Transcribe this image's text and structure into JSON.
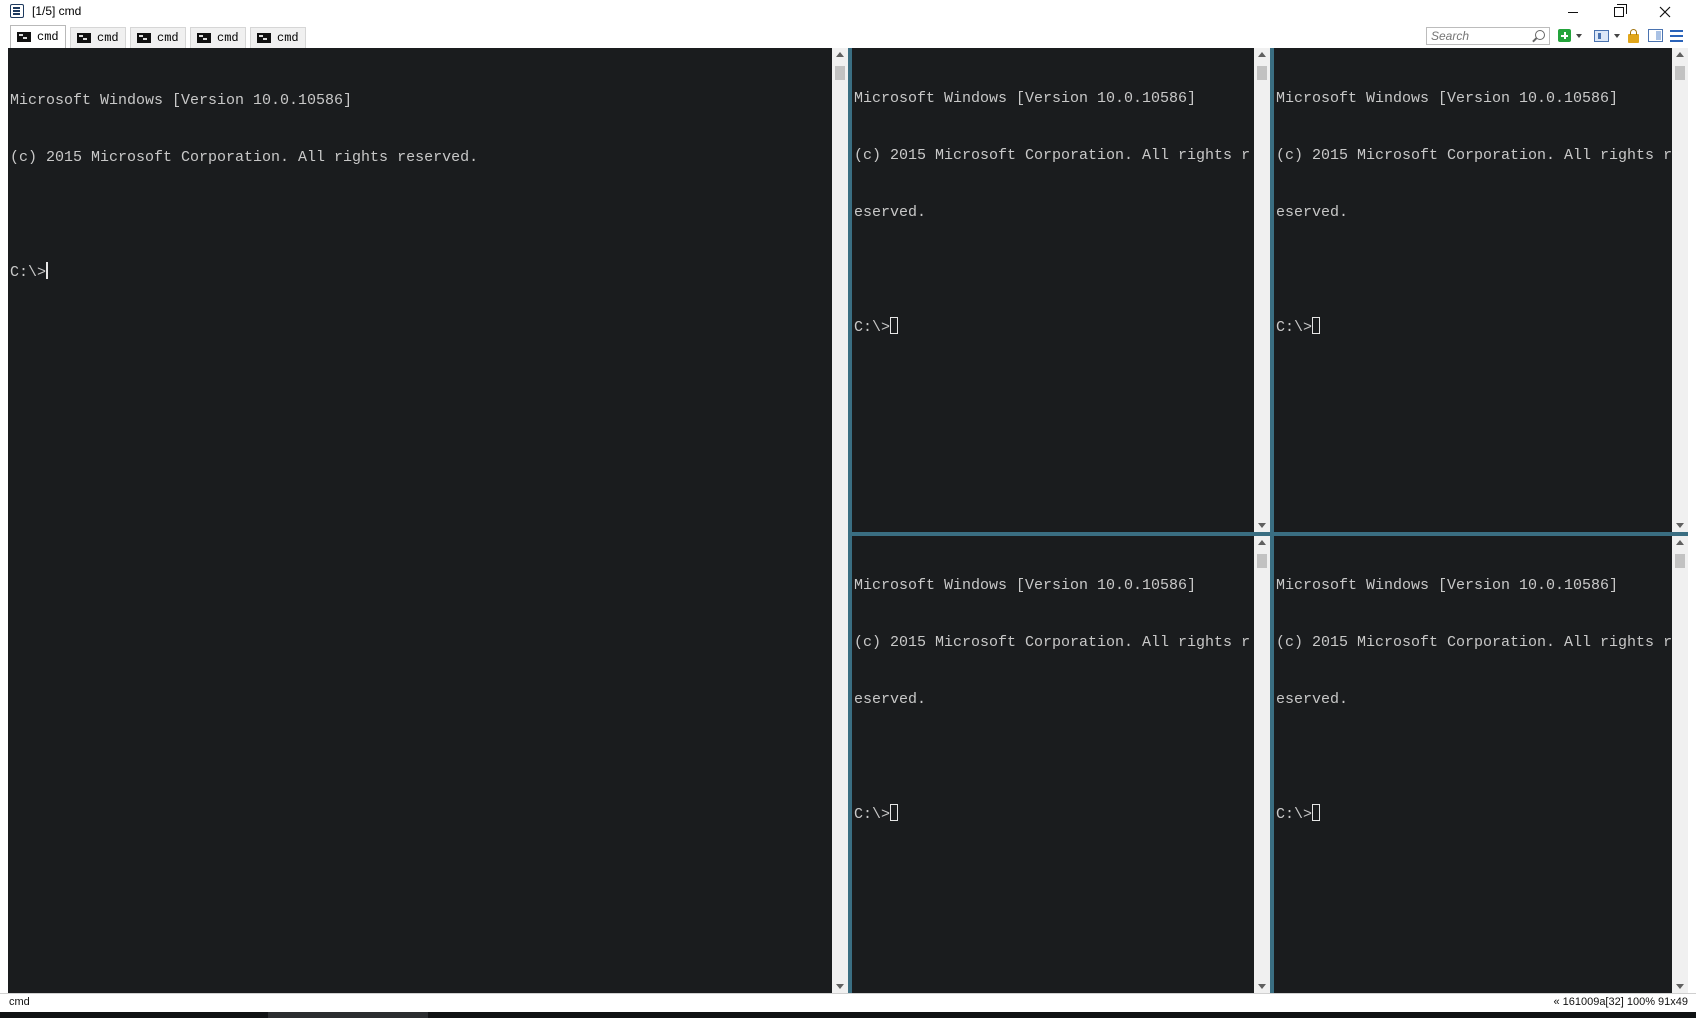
{
  "window": {
    "title": "[1/5] cmd"
  },
  "tabs": [
    {
      "label": "cmd",
      "active": true
    },
    {
      "label": "cmd",
      "active": false
    },
    {
      "label": "cmd",
      "active": false
    },
    {
      "label": "cmd",
      "active": false
    },
    {
      "label": "cmd",
      "active": false
    }
  ],
  "toolbar": {
    "search_placeholder": "Search",
    "icons": [
      "add-console-icon",
      "dropdown-icon",
      "split-view-icon",
      "dropdown-icon",
      "lock-icon",
      "panel-icon",
      "menu-icon"
    ]
  },
  "panes": {
    "main": {
      "line1": "Microsoft Windows [Version 10.0.10586]",
      "line2": "(c) 2015 Microsoft Corporation. All rights reserved.",
      "prompt": "C:\\>"
    },
    "top_middle": {
      "line1": "Microsoft Windows [Version 10.0.10586]",
      "line2": "(c) 2015 Microsoft Corporation. All rights r",
      "line3": "eserved.",
      "prompt": "C:\\>"
    },
    "top_right": {
      "line1": "Microsoft Windows [Version 10.0.10586]",
      "line2": "(c) 2015 Microsoft Corporation. All rights r",
      "line3": "eserved.",
      "prompt": "C:\\>"
    },
    "bottom_middle": {
      "line1": "Microsoft Windows [Version 10.0.10586]",
      "line2": "(c) 2015 Microsoft Corporation. All rights r",
      "line3": "eserved.",
      "prompt": "C:\\>"
    },
    "bottom_right": {
      "line1": "Microsoft Windows [Version 10.0.10586]",
      "line2": "(c) 2015 Microsoft Corporation. All rights r",
      "line3": "eserved.",
      "prompt": "C:\\>"
    }
  },
  "statusbar": {
    "left": "cmd",
    "right": "« 161009a[32]  100%  91x49"
  },
  "colors": {
    "terminal_bg": "#1a1c1e",
    "terminal_fg": "#c8c8c8",
    "splitter": "#3a6e82"
  }
}
